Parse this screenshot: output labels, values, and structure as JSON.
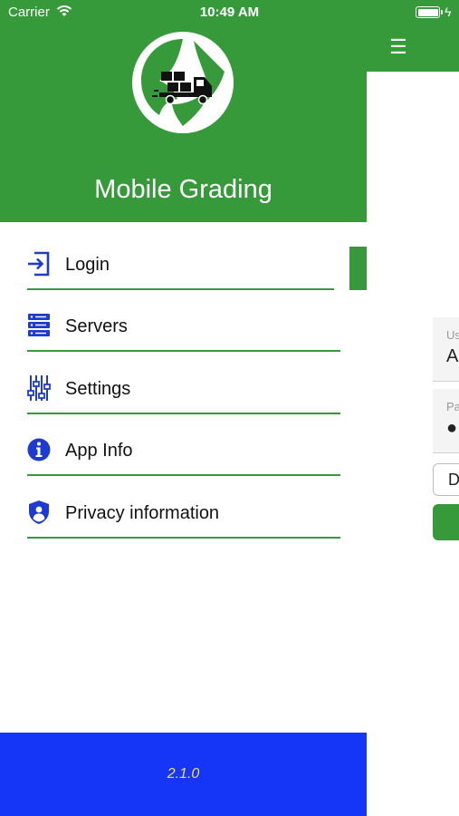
{
  "status_bar": {
    "carrier": "Carrier",
    "time": "10:49 AM",
    "icons": [
      "wifi-icon",
      "battery-icon",
      "charging-bolt-icon"
    ]
  },
  "app": {
    "menu_icon": "hamburger-icon",
    "form": {
      "username_label": "Us",
      "username_value": "A",
      "password_label": "Pa",
      "password_value": "●",
      "domain_value": "D"
    }
  },
  "drawer": {
    "logo": "delivery-truck-logo",
    "title": "Mobile Grading",
    "items": [
      {
        "label": "Login",
        "icon": "login-icon"
      },
      {
        "label": "Servers",
        "icon": "servers-icon"
      },
      {
        "label": "Settings",
        "icon": "sliders-icon"
      },
      {
        "label": "App Info",
        "icon": "info-icon"
      },
      {
        "label": "Privacy information",
        "icon": "shield-user-icon"
      }
    ],
    "version": "2.1.0"
  },
  "colors": {
    "brand_green": "#369a3b",
    "footer_blue": "#1536f7",
    "icon_blue": "#1e3bd1",
    "version_yellow": "#f7df3e"
  }
}
